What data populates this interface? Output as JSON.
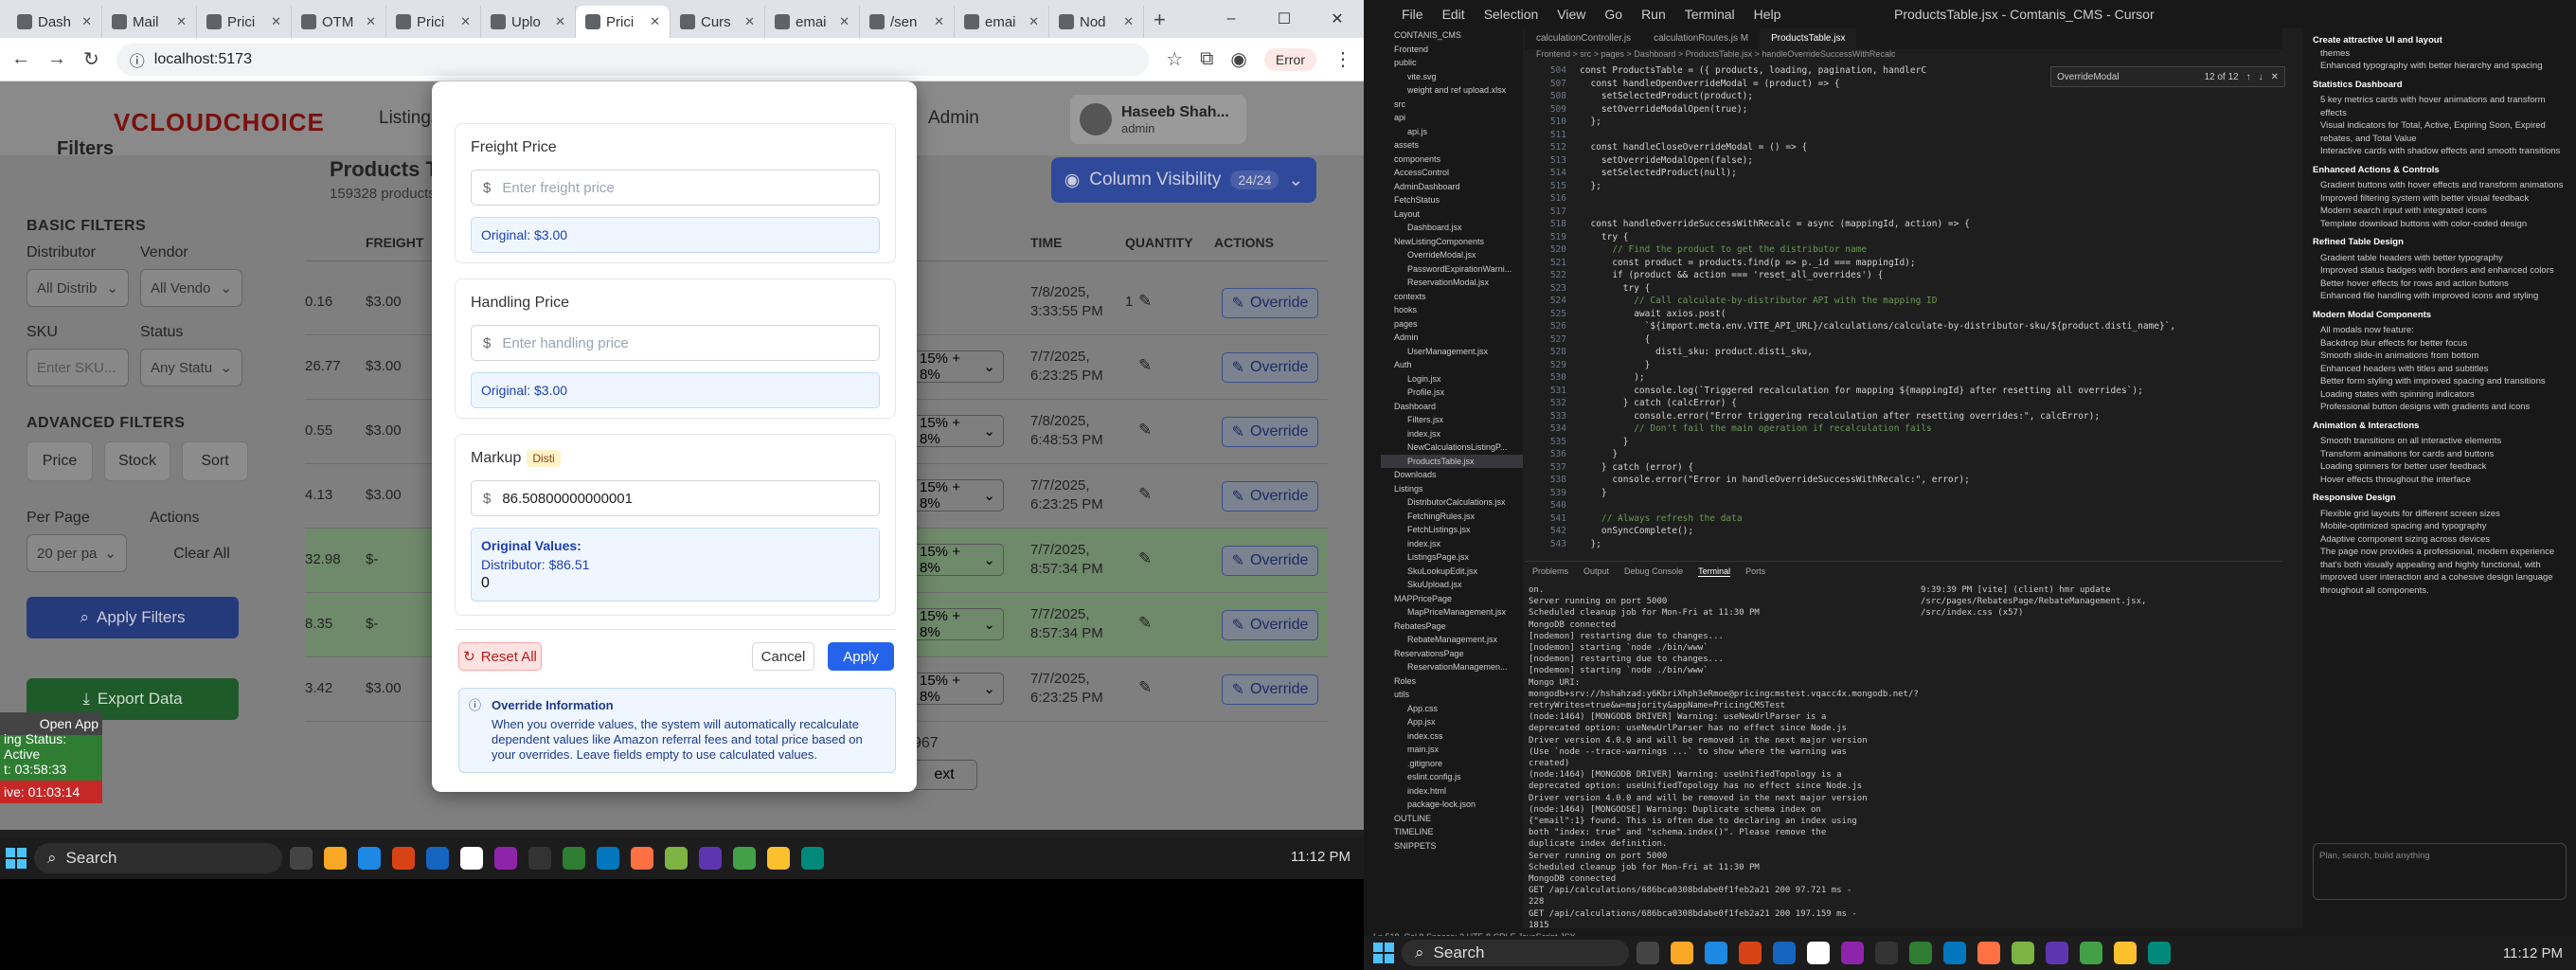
{
  "browser": {
    "tabs": [
      "Dash",
      "Mail",
      "Prici",
      "OTM",
      "Prici",
      "Uplo",
      "Prici",
      "Curs",
      "emai",
      "/sen",
      "emai",
      "Nod"
    ],
    "active_tab": 6,
    "url": "localhost:5173",
    "error_label": "Error"
  },
  "app": {
    "logo": "VCLOUDCHOICE",
    "nav": [
      "Listings",
      "Admin"
    ],
    "user_name": "Haseeb Shah...",
    "user_role": "admin",
    "page_title": "Products Tab",
    "product_count": "159328 products",
    "filters_label": "Filters",
    "basic_filters": "BASIC FILTERS",
    "distributor_label": "Distributor",
    "distributor_value": "All Distrib",
    "vendor_label": "Vendor",
    "vendor_value": "All Vendo",
    "sku_label": "SKU",
    "sku_placeholder": "Enter SKU...",
    "status_label": "Status",
    "status_value": "Any Statu",
    "advanced_filters": "ADVANCED FILTERS",
    "adv_buttons": [
      "Price",
      "Stock",
      "Sort"
    ],
    "per_page_label": "Per Page",
    "per_page_value": "20 per pa",
    "actions_label": "Actions",
    "clear_all": "Clear All",
    "apply_filters": "Apply Filters",
    "export_data": "Export Data",
    "column_visibility": "Column Visibility",
    "column_count": "24/24",
    "headers": [
      "FREIGHT",
      "TIME",
      "QUANTITY",
      "ACTIONS"
    ],
    "rows": [
      {
        "a": "0.16",
        "freight": "$3.00",
        "markup": "",
        "date": "7/8/2025,",
        "time": "3:33:55 PM",
        "qty": "1"
      },
      {
        "a": "26.77",
        "freight": "$3.00",
        "markup": "15% + 8%",
        "date": "7/7/2025,",
        "time": "6:23:25 PM",
        "qty": ""
      },
      {
        "a": "0.55",
        "freight": "$3.00",
        "markup": "15% + 8%",
        "date": "7/8/2025,",
        "time": "6:48:53 PM",
        "qty": ""
      },
      {
        "a": "4.13",
        "freight": "$3.00",
        "markup": "15% + 8%",
        "date": "7/7/2025,",
        "time": "6:23:25 PM",
        "qty": ""
      },
      {
        "a": "32.98",
        "freight": "$-",
        "markup": "15% + 8%",
        "date": "7/7/2025,",
        "time": "8:57:34 PM",
        "qty": ""
      },
      {
        "a": "8.35",
        "freight": "$-",
        "markup": "15% + 8%",
        "date": "7/7/2025,",
        "time": "8:57:34 PM",
        "qty": ""
      },
      {
        "a": "3.42",
        "freight": "$3.00",
        "markup": "15% + 8%",
        "date": "7/7/2025,",
        "time": "6:23:25 PM",
        "qty": ""
      }
    ],
    "override_label": "Override",
    "pagination_count": "967",
    "next_label": "ext",
    "open_app": "Open App",
    "status_active": "ing Status: Active",
    "timer1": "t: 03:58:33",
    "timer2": "ive: 01:03:14"
  },
  "modal": {
    "freight": {
      "label": "Freight Price",
      "placeholder": "Enter freight price",
      "original": "Original: $3.00"
    },
    "handling": {
      "label": "Handling Price",
      "placeholder": "Enter handling price",
      "original": "Original: $3.00"
    },
    "markup": {
      "label": "Markup",
      "badge": "Disti",
      "value": "86.50800000000001",
      "orig_title": "Original Values:",
      "orig_dist": "Distributor: $86.51",
      "orig_zero": "0"
    },
    "reset": "Reset All",
    "cancel": "Cancel",
    "apply": "Apply",
    "info_title": "Override Information",
    "info_text": "When you override values, the system will automatically recalculate dependent values like Amazon referral fees and total price based on your overrides. Leave fields empty to use calculated values."
  },
  "taskbar": {
    "search": "Search",
    "clock": "11:12 PM"
  },
  "vscode": {
    "menu": [
      "File",
      "Edit",
      "Selection",
      "View",
      "Go",
      "Run",
      "Terminal",
      "Help"
    ],
    "title": "ProductsTable.jsx - Comtanis_CMS - Cursor",
    "tabs": [
      "calculationController.js",
      "calculationRoutes.js M",
      "ProductsTable.jsx"
    ],
    "breadcrumb": "Frontend > src > pages > Dashboard > ProductsTable.jsx > handleOverrideSuccessWithRecalc",
    "find_text": "OverrideModal",
    "find_count": "12 of 12",
    "explorer": [
      "CONTANIS_CMS",
      "Frontend",
      "public",
      "vite.svg",
      "weight and ref upload.xlsx",
      "src",
      "api",
      "api.js",
      "assets",
      "components",
      "AccessControl",
      "AdminDashboard",
      "FetchStatus",
      "Layout",
      "Dashboard.jsx",
      "NewListingComponents",
      "OverrideModal.jsx",
      "PasswordExpirationWarni...",
      "ReservationModal.jsx",
      "contexts",
      "hooks",
      "pages",
      "Admin",
      "UserManagement.jsx",
      "Auth",
      "Login.jsx",
      "Profile.jsx",
      "Dashboard",
      "Filters.jsx",
      "index.jsx",
      "NewCalculationsListingP...",
      "ProductsTable.jsx",
      "Downloads",
      "Listings",
      "DistributorCalculations.jsx",
      "FetchingRules.jsx",
      "FetchListings.jsx",
      "index.jsx",
      "ListingsPage.jsx",
      "SkuLookupEdit.jsx",
      "SkuUpload.jsx",
      "MAPPricePage",
      "MapPriceManagement.jsx",
      "RebatesPage",
      "RebateManagement.jsx",
      "ReservationsPage",
      "ReservationManagemen...",
      "Roles",
      "utils",
      "App.css",
      "App.jsx",
      "index.css",
      "main.jsx",
      ".gitignore",
      "eslint.config.js",
      "index.html",
      "package-lock.json",
      "OUTLINE",
      "TIMELINE",
      "SNIPPETS"
    ],
    "code": [
      {
        "n": "504",
        "t": "const ProductsTable = ({ products, loading, pagination, handlerC"
      },
      {
        "n": "507",
        "t": "  const handleOpenOverrideModal = (product) => {"
      },
      {
        "n": "508",
        "t": "    setSelectedProduct(product);"
      },
      {
        "n": "509",
        "t": "    setOverrideModalOpen(true);"
      },
      {
        "n": "510",
        "t": "  };"
      },
      {
        "n": "511",
        "t": ""
      },
      {
        "n": "512",
        "t": "  const handleCloseOverrideModal = () => {"
      },
      {
        "n": "513",
        "t": "    setOverrideModalOpen(false);"
      },
      {
        "n": "514",
        "t": "    setSelectedProduct(null);"
      },
      {
        "n": "515",
        "t": "  };"
      },
      {
        "n": "516",
        "t": ""
      },
      {
        "n": "517",
        "t": ""
      },
      {
        "n": "518",
        "t": "  const handleOverrideSuccessWithRecalc = async (mappingId, action) => {"
      },
      {
        "n": "519",
        "t": "    try {"
      },
      {
        "n": "520",
        "t": "      // Find the product to get the distributor name"
      },
      {
        "n": "521",
        "t": "      const product = products.find(p => p._id === mappingId);"
      },
      {
        "n": "522",
        "t": "      if (product && action === 'reset_all_overrides') {"
      },
      {
        "n": "523",
        "t": "        try {"
      },
      {
        "n": "524",
        "t": "          // Call calculate-by-distributor API with the mapping ID"
      },
      {
        "n": "525",
        "t": "          await axios.post("
      },
      {
        "n": "526",
        "t": "            `${import.meta.env.VITE_API_URL}/calculations/calculate-by-distributor-sku/${product.disti_name}`,"
      },
      {
        "n": "527",
        "t": "            {"
      },
      {
        "n": "528",
        "t": "              disti_sku: product.disti_sku,"
      },
      {
        "n": "529",
        "t": "            }"
      },
      {
        "n": "530",
        "t": "          );"
      },
      {
        "n": "531",
        "t": "          console.log(`Triggered recalculation for mapping ${mappingId} after resetting all overrides`);"
      },
      {
        "n": "532",
        "t": "        } catch (calcError) {"
      },
      {
        "n": "533",
        "t": "          console.error(\"Error triggering recalculation after resetting overrides:\", calcError);"
      },
      {
        "n": "534",
        "t": "          // Don't fail the main operation if recalculation fails"
      },
      {
        "n": "535",
        "t": "        }"
      },
      {
        "n": "536",
        "t": "      }"
      },
      {
        "n": "537",
        "t": "    } catch (error) {"
      },
      {
        "n": "538",
        "t": "      console.error(\"Error in handleOverrideSuccessWithRecalc:\", error);"
      },
      {
        "n": "539",
        "t": "    }"
      },
      {
        "n": "540",
        "t": ""
      },
      {
        "n": "541",
        "t": "    // Always refresh the data"
      },
      {
        "n": "542",
        "t": "    onSyncComplete();"
      },
      {
        "n": "543",
        "t": "  };"
      }
    ],
    "term_tabs": [
      "Problems",
      "Output",
      "Debug Console",
      "Terminal",
      "Ports"
    ],
    "term_log": "on.\nServer running on port 5000\nScheduled cleanup job for Mon-Fri at 11:30 PM\nMongoDB connected\n[nodemon] restarting due to changes...\n[nodemon] starting `node ./bin/www`\n[nodemon] restarting due to changes...\n[nodemon] starting `node ./bin/www`\nMongo URI: mongodb+srv://hshahzad:y6KbriXhph3eRmoe@pricingcmstest.vqacc4x.mongodb.net/?retryWrites=true&w=majority&appName=PricingCMSTest\n(node:1464) [MONGODB DRIVER] Warning: useNewUrlParser is a deprecated option: useNewUrlParser has no effect since Node.js Driver version 4.0.0 and will be removed in the next major version\n(Use `node --trace-warnings ...` to show where the warning was created)\n(node:1464) [MONGODB DRIVER] Warning: useUnifiedTopology is a deprecated option: useUnifiedTopology has no effect since Node.js Driver version 4.0.0 and will be removed in the next major version\n(node:1464) [MONGOOSE] Warning: Duplicate schema index on {\"email\":1} found. This is often due to declaring an index using both \"index: true\" and \"schema.index()\". Please remove the duplicate index definition.\nServer running on port 5000\nScheduled cleanup job for Mon-Fri at 11:30 PM\nMongoDB connected\nGET /api/calculations/686bca0308bdabe0f1feb2a21 200 97.721 ms - 228\nGET /api/calculations/686bca0308bdabe0f1feb2a21 200 197.159 ms - 1815",
    "term_log2": "9:39:39 PM [vite] (client) hmr update /src/pages/RebatesPage/RebateManagement.jsx, /src/index.css (x57)",
    "chat_title": "Create attractive UI and layout",
    "chat": [
      {
        "h": "",
        "items": [
          "themes",
          "Enhanced typography with better hierarchy and spacing"
        ]
      },
      {
        "h": "Statistics Dashboard",
        "items": [
          "5 key metrics cards with hover animations and transform effects",
          "Visual indicators for Total, Active, Expiring Soon, Expired rebates, and Total Value",
          "Interactive cards with shadow effects and smooth transitions"
        ]
      },
      {
        "h": "Enhanced Actions & Controls",
        "items": [
          "Gradient buttons with hover effects and transform animations",
          "Improved filtering system with better visual feedback",
          "Modern search input with integrated icons",
          "Template download buttons with color-coded design"
        ]
      },
      {
        "h": "Refined Table Design",
        "items": [
          "Gradient table headers with better typography",
          "Improved status badges with borders and enhanced colors",
          "Better hover effects for rows and action buttons",
          "Enhanced file handling with improved icons and styling"
        ]
      },
      {
        "h": "Modern Modal Components",
        "items": [
          "All modals now feature:",
          "Backdrop blur effects for better focus",
          "Smooth slide-in animations from bottom",
          "Enhanced headers with titles and subtitles",
          "Better form styling with improved spacing and transitions",
          "Loading states with spinning indicators",
          "Professional button designs with gradients and icons"
        ]
      },
      {
        "h": "Animation & Interactions",
        "items": [
          "Smooth transitions on all interactive elements",
          "Transform animations for cards and buttons",
          "Loading spinners for better user feedback",
          "Hover effects throughout the interface"
        ]
      },
      {
        "h": "Responsive Design",
        "items": [
          "Flexible grid layouts for different screen sizes",
          "Mobile-optimized spacing and typography",
          "Adaptive component sizing across devices",
          "The page now provides a professional, modern experience that's both visually appealing and highly functional, with improved user interaction and a cohesive design language throughout all components."
        ]
      }
    ],
    "chat_input": "Plan, search, build anything",
    "status": "Ln 518, Col 9   Spaces: 2   UTF-8   CRLF   JavaScript JSX",
    "clock": "11:12 PM"
  }
}
